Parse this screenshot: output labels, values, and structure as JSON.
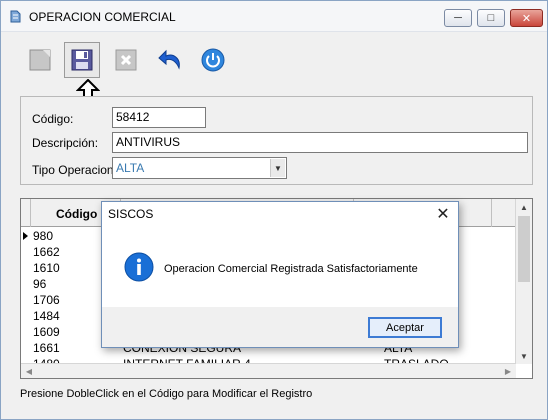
{
  "window": {
    "title": "OPERACION COMERCIAL"
  },
  "toolbar": {
    "new_icon": "new-page-icon",
    "save_icon": "floppy-disk-icon",
    "cancel_icon": "delete-x-icon",
    "undo_icon": "undo-arrow-icon",
    "exit_icon": "power-icon"
  },
  "form": {
    "codigo_label": "Código:",
    "codigo_value": "58412",
    "descripcion_label": "Descripción:",
    "descripcion_value": "ANTIVIRUS",
    "tipo_label": "Tipo Operacion",
    "tipo_value": "ALTA"
  },
  "grid": {
    "columns": [
      "Código",
      "",
      ""
    ],
    "rows": [
      {
        "codigo": "980",
        "descripcion": "",
        "tipo": ""
      },
      {
        "codigo": "1662",
        "descripcion": "",
        "tipo": ""
      },
      {
        "codigo": "1610",
        "descripcion": "",
        "tipo": ""
      },
      {
        "codigo": "96",
        "descripcion": "",
        "tipo": ""
      },
      {
        "codigo": "1706",
        "descripcion": "",
        "tipo": ""
      },
      {
        "codigo": "1484",
        "descripcion": "",
        "tipo": ""
      },
      {
        "codigo": "1609",
        "descripcion": "",
        "tipo": ""
      },
      {
        "codigo": "1661",
        "descripcion": "CONEXION SEGURA",
        "tipo": "ALTA"
      },
      {
        "codigo": "1480",
        "descripcion": "INTERNET FAMILIAR 4",
        "tipo": "TRASLADO"
      }
    ]
  },
  "status": {
    "text": "Presione DobleClick en el Código para Modificar el Registro"
  },
  "dialog": {
    "title": "SISCOS",
    "message": "Operacion Comercial Registrada Satisfactoriamente",
    "ok_label": "Aceptar"
  },
  "colors": {
    "accent": "#3d7bd4",
    "title_close": "#c9463b",
    "select_text": "#3a7ab0"
  }
}
